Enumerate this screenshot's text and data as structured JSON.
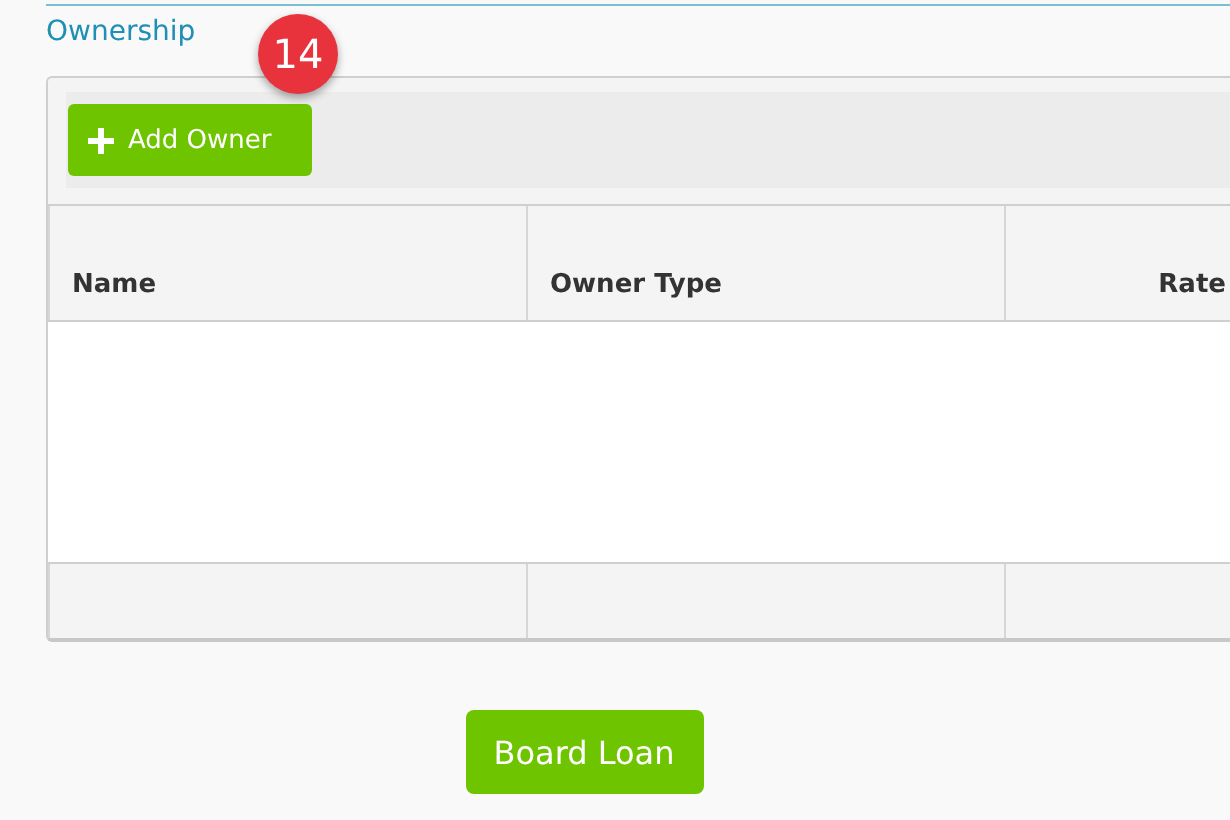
{
  "section_title": "Ownership",
  "step_badge": "14",
  "toolbar": {
    "add_button": "Add Owner"
  },
  "table": {
    "columns": [
      "Name",
      "Owner Type",
      "Rate"
    ]
  },
  "submit_button": "Board Loan"
}
